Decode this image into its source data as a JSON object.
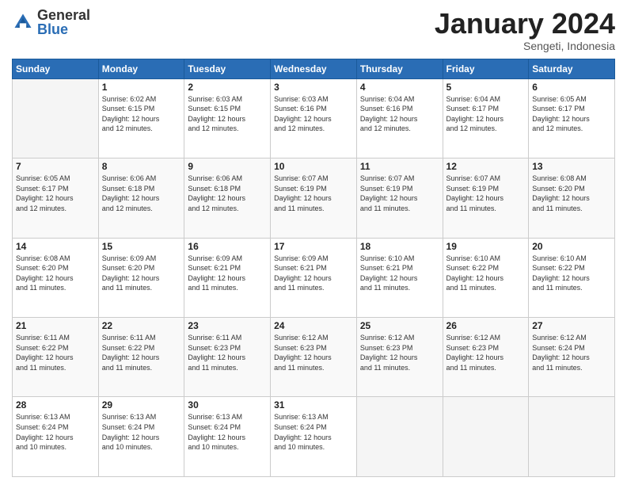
{
  "header": {
    "logo": {
      "general": "General",
      "blue": "Blue"
    },
    "title": "January 2024",
    "subtitle": "Sengeti, Indonesia"
  },
  "weekdays": [
    "Sunday",
    "Monday",
    "Tuesday",
    "Wednesday",
    "Thursday",
    "Friday",
    "Saturday"
  ],
  "weeks": [
    [
      {
        "day": "",
        "info": ""
      },
      {
        "day": "1",
        "info": "Sunrise: 6:02 AM\nSunset: 6:15 PM\nDaylight: 12 hours\nand 12 minutes."
      },
      {
        "day": "2",
        "info": "Sunrise: 6:03 AM\nSunset: 6:15 PM\nDaylight: 12 hours\nand 12 minutes."
      },
      {
        "day": "3",
        "info": "Sunrise: 6:03 AM\nSunset: 6:16 PM\nDaylight: 12 hours\nand 12 minutes."
      },
      {
        "day": "4",
        "info": "Sunrise: 6:04 AM\nSunset: 6:16 PM\nDaylight: 12 hours\nand 12 minutes."
      },
      {
        "day": "5",
        "info": "Sunrise: 6:04 AM\nSunset: 6:17 PM\nDaylight: 12 hours\nand 12 minutes."
      },
      {
        "day": "6",
        "info": "Sunrise: 6:05 AM\nSunset: 6:17 PM\nDaylight: 12 hours\nand 12 minutes."
      }
    ],
    [
      {
        "day": "7",
        "info": "Sunrise: 6:05 AM\nSunset: 6:17 PM\nDaylight: 12 hours\nand 12 minutes."
      },
      {
        "day": "8",
        "info": "Sunrise: 6:06 AM\nSunset: 6:18 PM\nDaylight: 12 hours\nand 12 minutes."
      },
      {
        "day": "9",
        "info": "Sunrise: 6:06 AM\nSunset: 6:18 PM\nDaylight: 12 hours\nand 12 minutes."
      },
      {
        "day": "10",
        "info": "Sunrise: 6:07 AM\nSunset: 6:19 PM\nDaylight: 12 hours\nand 11 minutes."
      },
      {
        "day": "11",
        "info": "Sunrise: 6:07 AM\nSunset: 6:19 PM\nDaylight: 12 hours\nand 11 minutes."
      },
      {
        "day": "12",
        "info": "Sunrise: 6:07 AM\nSunset: 6:19 PM\nDaylight: 12 hours\nand 11 minutes."
      },
      {
        "day": "13",
        "info": "Sunrise: 6:08 AM\nSunset: 6:20 PM\nDaylight: 12 hours\nand 11 minutes."
      }
    ],
    [
      {
        "day": "14",
        "info": "Sunrise: 6:08 AM\nSunset: 6:20 PM\nDaylight: 12 hours\nand 11 minutes."
      },
      {
        "day": "15",
        "info": "Sunrise: 6:09 AM\nSunset: 6:20 PM\nDaylight: 12 hours\nand 11 minutes."
      },
      {
        "day": "16",
        "info": "Sunrise: 6:09 AM\nSunset: 6:21 PM\nDaylight: 12 hours\nand 11 minutes."
      },
      {
        "day": "17",
        "info": "Sunrise: 6:09 AM\nSunset: 6:21 PM\nDaylight: 12 hours\nand 11 minutes."
      },
      {
        "day": "18",
        "info": "Sunrise: 6:10 AM\nSunset: 6:21 PM\nDaylight: 12 hours\nand 11 minutes."
      },
      {
        "day": "19",
        "info": "Sunrise: 6:10 AM\nSunset: 6:22 PM\nDaylight: 12 hours\nand 11 minutes."
      },
      {
        "day": "20",
        "info": "Sunrise: 6:10 AM\nSunset: 6:22 PM\nDaylight: 12 hours\nand 11 minutes."
      }
    ],
    [
      {
        "day": "21",
        "info": "Sunrise: 6:11 AM\nSunset: 6:22 PM\nDaylight: 12 hours\nand 11 minutes."
      },
      {
        "day": "22",
        "info": "Sunrise: 6:11 AM\nSunset: 6:22 PM\nDaylight: 12 hours\nand 11 minutes."
      },
      {
        "day": "23",
        "info": "Sunrise: 6:11 AM\nSunset: 6:23 PM\nDaylight: 12 hours\nand 11 minutes."
      },
      {
        "day": "24",
        "info": "Sunrise: 6:12 AM\nSunset: 6:23 PM\nDaylight: 12 hours\nand 11 minutes."
      },
      {
        "day": "25",
        "info": "Sunrise: 6:12 AM\nSunset: 6:23 PM\nDaylight: 12 hours\nand 11 minutes."
      },
      {
        "day": "26",
        "info": "Sunrise: 6:12 AM\nSunset: 6:23 PM\nDaylight: 12 hours\nand 11 minutes."
      },
      {
        "day": "27",
        "info": "Sunrise: 6:12 AM\nSunset: 6:24 PM\nDaylight: 12 hours\nand 11 minutes."
      }
    ],
    [
      {
        "day": "28",
        "info": "Sunrise: 6:13 AM\nSunset: 6:24 PM\nDaylight: 12 hours\nand 10 minutes."
      },
      {
        "day": "29",
        "info": "Sunrise: 6:13 AM\nSunset: 6:24 PM\nDaylight: 12 hours\nand 10 minutes."
      },
      {
        "day": "30",
        "info": "Sunrise: 6:13 AM\nSunset: 6:24 PM\nDaylight: 12 hours\nand 10 minutes."
      },
      {
        "day": "31",
        "info": "Sunrise: 6:13 AM\nSunset: 6:24 PM\nDaylight: 12 hours\nand 10 minutes."
      },
      {
        "day": "",
        "info": ""
      },
      {
        "day": "",
        "info": ""
      },
      {
        "day": "",
        "info": ""
      }
    ]
  ]
}
